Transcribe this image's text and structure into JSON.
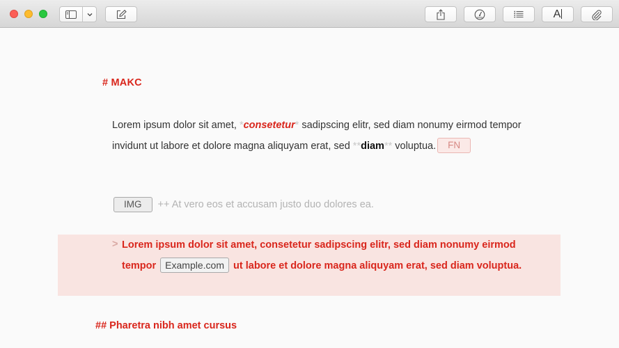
{
  "toolbar": {
    "icons": [
      "sidebar-icon",
      "chevron-down-icon",
      "compose-icon",
      "share-icon",
      "stats-gauge-icon",
      "outline-list-icon",
      "font-icon",
      "paperclip-icon"
    ],
    "font_button_glyph": "A"
  },
  "document": {
    "heading1": "# MAKC",
    "paragraph": {
      "text_start": "Lorem ipsum dolor sit amet, ",
      "em_open": "*",
      "em_text": "consetetur",
      "em_close": "*",
      "text_middle": " sadipscing elitr, sed diam nonumy eirmod tempor invidunt ut labore et dolore magna aliquyam erat, sed ",
      "strong_open": "**",
      "strong_text": "diam",
      "strong_close": "**",
      "text_end": " voluptua.",
      "footnote_label": "FN"
    },
    "image_line": {
      "image_label": "IMG",
      "caption": "++ At vero eos et accusam justo duo dolores ea."
    },
    "blockquote": {
      "marker": ">",
      "text_start": "Lorem ipsum dolor sit amet, consetetur sadipscing elitr, sed diam nonumy eirmod tempor ",
      "link_label": "Example.com",
      "text_end": " ut labore et dolore magna aliquyam erat, sed diam voluptua."
    },
    "heading2": "## Pharetra nibh amet cursus"
  },
  "colors": {
    "accent_red": "#d9261c",
    "quote_background": "#f9e4e1",
    "syntax_gray": "#c8c8c8"
  }
}
